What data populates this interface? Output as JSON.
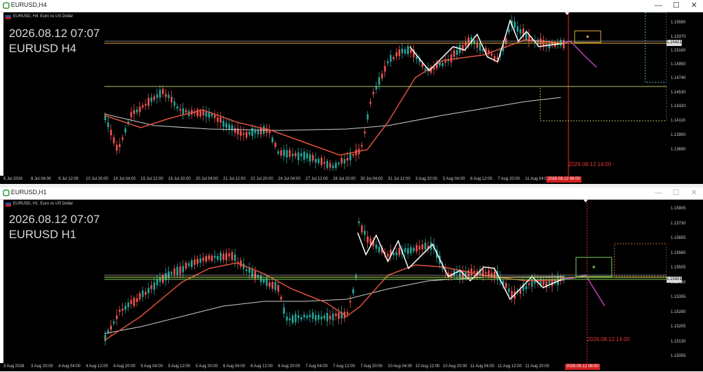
{
  "windows": [
    {
      "title": "EURUSD,H4",
      "subtitle": "EURUSD, H4:  Euro vs US Dollar",
      "overlay_date": "2026.08.12 07:07",
      "overlay_symbol": "EURUSD H4",
      "vline_label": "2026.08.12 14:00",
      "current_price": "1.15421",
      "time_marker": "2026.08.12 08:00",
      "price_ticks": [
        "1.15590",
        "1.15370",
        "1.15160",
        "1.14950",
        "1.14740",
        "1.14530",
        "1.14320",
        "1.14110",
        "1.13900",
        "1.13690"
      ],
      "time_ticks": [
        "6 Jul 2026",
        "8 Jul 04:00",
        "9 Jul 12:00",
        "10 Jul 20:00",
        "14 Jul 04:00",
        "15 Jul 12:00",
        "16 Jul 20:00",
        "20 Jul 04:00",
        "21 Jul 12:00",
        "22 Jul 20:00",
        "24 Jul 04:00",
        "27 Jul 12:00",
        "28 Jul 20:00",
        "30 Jul 04:00",
        "31 Jul 12:00",
        "3 Aug 20:00",
        "5 Aug 04:00",
        "6 Aug 12:00",
        "7 Aug 20:00",
        "11 Aug 04:00"
      ],
      "colors": {
        "bull": "#26a69a",
        "bear": "#ef5350",
        "ema": "#e0533e",
        "sma": "#cfcfcf",
        "zigzag": "#ffffff",
        "forecast": "#c23fc2",
        "level1": "#e6b13a",
        "level2": "#b5c75a",
        "vline": "#e33030"
      }
    },
    {
      "title": "EURUSD,H1",
      "subtitle": "EURUSD, H1:  Euro vs US Dollar",
      "overlay_date": "2026.08.12 07:07",
      "overlay_symbol": "EURUSD H1",
      "vline_label": "2026.08.12 14:00",
      "current_price": "1.15421",
      "time_marker": "2026.08.12 08:00",
      "price_ticks": [
        "1.15805",
        "1.15730",
        "1.15655",
        "1.15580",
        "1.15505",
        "1.15430",
        "1.15355",
        "1.15280",
        "1.15205",
        "1.15130",
        "1.15055"
      ],
      "time_ticks": [
        "3 Aug 2026",
        "3 Aug 20:00",
        "4 Aug 04:00",
        "4 Aug 12:00",
        "4 Aug 20:00",
        "5 Aug 04:00",
        "5 Aug 12:00",
        "5 Aug 20:00",
        "6 Aug 04:00",
        "6 Aug 12:00",
        "6 Aug 20:00",
        "7 Aug 04:00",
        "7 Aug 12:00",
        "7 Aug 20:00",
        "10 Aug 04:00",
        "10 Aug 12:00",
        "10 Aug 20:00",
        "11 Aug 04:00",
        "11 Aug 12:00",
        "11 Aug 20:00"
      ],
      "colors": {
        "bull": "#26a69a",
        "bear": "#ef5350",
        "ema": "#e0533e",
        "sma": "#cfcfcf",
        "zigzag": "#ffffff",
        "forecast": "#c23fc2",
        "level1": "#c8e25a",
        "level2": "#7fd35a",
        "vline": "#e33030"
      }
    }
  ],
  "window_buttons": {
    "minimize": "—",
    "maximize": "☐",
    "close": "✕"
  }
}
